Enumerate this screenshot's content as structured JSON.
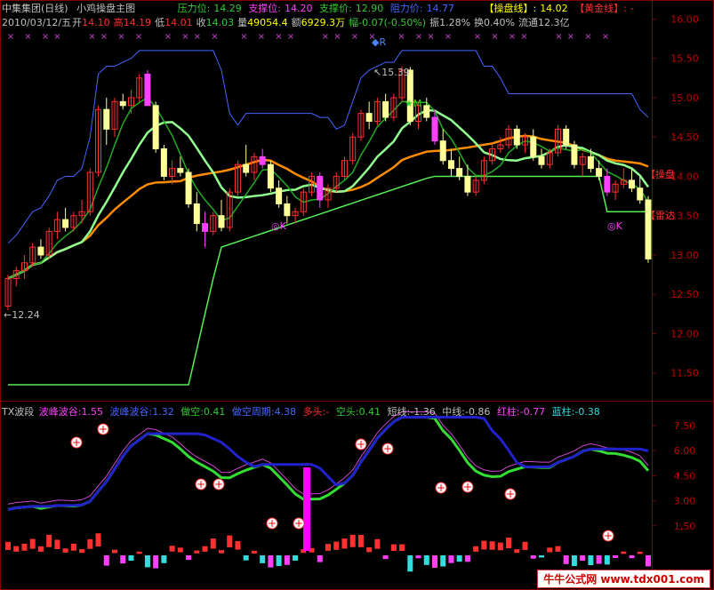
{
  "header": {
    "stock": "中集集团(日线)",
    "indicator_name": "小鸡操盘主图",
    "date": "2010/03/12/五",
    "open_label": "开",
    "open": "14.10",
    "high_label": "高",
    "high": "14.19",
    "low_label": "低",
    "low": "14.01",
    "close_label": "收",
    "close": "14.03",
    "volume_label": "量",
    "volume": "49054.4",
    "amount_label": "额",
    "amount": "6929.3万",
    "change_label": "幅",
    "change": "-0.07(-0.50%)",
    "amplitude_label": "振",
    "amplitude": "1.28%",
    "turnover_label": "换",
    "turnover": "0.40%",
    "float_label": "流通",
    "float": "12.3亿",
    "pressure_label": "压力位:",
    "pressure": "14.29",
    "support_label": "支撑位:",
    "support": "14.20",
    "support_price_label": "支撑价:",
    "support_price": "12.90",
    "resistance_label": "阻力价:",
    "resistance": "14.77",
    "op_line_label": "【操盘线】:",
    "op_line": "14.02",
    "gold_line_label": "【黄金线】:",
    "gold_line": "-",
    "tag_caopan": "【操盘",
    "tag_leida": "【雷达",
    "high_note": "15.39",
    "low_note": "12.24",
    "mark_r": "◆R",
    "mark_m": "★M",
    "mark_k1": "◎K",
    "mark_k2": "◎K"
  },
  "sub_header": {
    "name": "TX波段",
    "wave_peak_label": "波峰波谷:",
    "wave_peak": "1.55",
    "wave_peak2_label": "波峰波谷:",
    "wave_peak2": "1.32",
    "short_label": "做空:",
    "short": "0.41",
    "short_cycle_label": "做空周期:",
    "short_cycle": "4.38",
    "long_label": "多头:",
    "long": "-",
    "empty_label": "空头:",
    "empty": "0.41",
    "short_line_label": "短线:",
    "short_line": "-1.36",
    "mid_line_label": "中线:",
    "mid_line": "-0.86",
    "red_bar_label": "红柱:",
    "red_bar": "-0.77",
    "blue_bar_label": "蓝柱:",
    "blue_bar": "-0.38"
  },
  "watermark": "牛牛公式网 www.tdx001.com",
  "colors": {
    "up": "#ff3030",
    "down_fill": "#ffff99",
    "flat_green": "#22aa22",
    "magenta": "#ff40ff",
    "ma_white": "#ffffff",
    "ma_orange": "#ff8c00",
    "ma_green": "#90ff90",
    "support_green": "#55ee55",
    "resist_blue": "#4466ff",
    "sub_green": "#33dd33",
    "sub_blue": "#2222cc",
    "sub_magenta": "#cc44cc"
  },
  "chart_data": {
    "type": "candlestick",
    "main_yaxis_ticks": [
      "16.00",
      "15.50",
      "15.00",
      "14.50",
      "14.00",
      "13.50",
      "13.00",
      "12.50",
      "12.00",
      "11.50"
    ],
    "main_ylim": [
      11.2,
      16.2
    ],
    "candles": [
      [
        12.35,
        12.75,
        12.3,
        12.7
      ],
      [
        12.7,
        12.85,
        12.6,
        12.8
      ],
      [
        12.8,
        13.0,
        12.7,
        12.9
      ],
      [
        12.9,
        13.15,
        12.85,
        13.1
      ],
      [
        13.1,
        13.2,
        12.95,
        13.0
      ],
      [
        13.0,
        13.35,
        12.95,
        13.3
      ],
      [
        13.3,
        13.55,
        13.2,
        13.45
      ],
      [
        13.45,
        13.6,
        13.3,
        13.35
      ],
      [
        13.35,
        13.55,
        13.3,
        13.5
      ],
      [
        13.5,
        13.7,
        13.4,
        13.55
      ],
      [
        13.55,
        14.1,
        13.5,
        14.05
      ],
      [
        14.05,
        14.9,
        14.0,
        14.85
      ],
      [
        14.85,
        15.0,
        14.4,
        14.6
      ],
      [
        14.6,
        15.0,
        14.5,
        14.95
      ],
      [
        14.95,
        15.05,
        14.85,
        14.9
      ],
      [
        14.9,
        15.1,
        14.8,
        15.0
      ],
      [
        15.0,
        15.3,
        14.95,
        15.25
      ],
      [
        15.3,
        15.35,
        14.9,
        14.9
      ],
      [
        14.9,
        14.95,
        14.3,
        14.35
      ],
      [
        14.35,
        14.4,
        13.95,
        14.0
      ],
      [
        14.0,
        14.2,
        13.9,
        14.1
      ],
      [
        14.1,
        14.25,
        14.0,
        14.05
      ],
      [
        14.05,
        14.1,
        13.6,
        13.65
      ],
      [
        13.65,
        13.8,
        13.3,
        13.4
      ],
      [
        13.4,
        13.55,
        13.1,
        13.3
      ],
      [
        13.3,
        13.55,
        13.25,
        13.5
      ],
      [
        13.5,
        13.7,
        13.3,
        13.35
      ],
      [
        13.35,
        13.85,
        13.3,
        13.8
      ],
      [
        13.8,
        14.2,
        13.75,
        14.15
      ],
      [
        14.15,
        14.4,
        14.0,
        14.05
      ],
      [
        14.05,
        14.3,
        13.95,
        14.25
      ],
      [
        14.25,
        14.35,
        14.1,
        14.15
      ],
      [
        14.15,
        14.2,
        13.8,
        13.85
      ],
      [
        13.85,
        13.95,
        13.6,
        13.65
      ],
      [
        13.65,
        13.75,
        13.4,
        13.5
      ],
      [
        13.5,
        13.6,
        13.4,
        13.55
      ],
      [
        13.55,
        13.85,
        13.5,
        13.8
      ],
      [
        13.8,
        14.05,
        13.75,
        14.0
      ],
      [
        14.0,
        14.05,
        13.6,
        13.7
      ],
      [
        13.7,
        13.9,
        13.6,
        13.85
      ],
      [
        13.85,
        14.05,
        13.8,
        14.0
      ],
      [
        14.0,
        14.25,
        13.95,
        14.2
      ],
      [
        14.2,
        14.55,
        14.15,
        14.5
      ],
      [
        14.5,
        14.85,
        14.45,
        14.8
      ],
      [
        14.8,
        14.95,
        14.6,
        14.7
      ],
      [
        14.7,
        15.0,
        14.65,
        14.95
      ],
      [
        14.95,
        15.05,
        14.7,
        14.75
      ],
      [
        14.75,
        15.05,
        14.7,
        15.0
      ],
      [
        15.0,
        15.4,
        14.95,
        15.35
      ],
      [
        15.35,
        15.39,
        14.65,
        14.7
      ],
      [
        14.7,
        14.95,
        14.6,
        14.9
      ],
      [
        14.9,
        15.0,
        14.7,
        14.75
      ],
      [
        14.75,
        14.85,
        14.4,
        14.45
      ],
      [
        14.45,
        14.6,
        14.15,
        14.2
      ],
      [
        14.2,
        14.35,
        14.0,
        14.1
      ],
      [
        14.1,
        14.25,
        13.95,
        14.0
      ],
      [
        14.0,
        14.15,
        13.75,
        13.8
      ],
      [
        13.8,
        14.0,
        13.75,
        13.95
      ],
      [
        13.95,
        14.25,
        13.9,
        14.2
      ],
      [
        14.2,
        14.4,
        14.15,
        14.35
      ],
      [
        14.35,
        14.5,
        14.3,
        14.4
      ],
      [
        14.4,
        14.65,
        14.35,
        14.6
      ],
      [
        14.6,
        14.65,
        14.35,
        14.4
      ],
      [
        14.4,
        14.55,
        14.3,
        14.5
      ],
      [
        14.5,
        14.6,
        14.2,
        14.25
      ],
      [
        14.25,
        14.35,
        14.1,
        14.15
      ],
      [
        14.15,
        14.35,
        14.1,
        14.3
      ],
      [
        14.3,
        14.65,
        14.25,
        14.6
      ],
      [
        14.6,
        14.65,
        14.35,
        14.4
      ],
      [
        14.4,
        14.45,
        14.1,
        14.15
      ],
      [
        14.15,
        14.3,
        14.0,
        14.25
      ],
      [
        14.25,
        14.35,
        14.05,
        14.1
      ],
      [
        14.1,
        14.2,
        13.95,
        14.0
      ],
      [
        14.0,
        14.1,
        13.75,
        13.8
      ],
      [
        13.8,
        13.95,
        13.7,
        13.9
      ],
      [
        13.9,
        14.1,
        13.85,
        13.95
      ],
      [
        13.95,
        14.1,
        13.8,
        13.85
      ],
      [
        13.85,
        14.0,
        13.65,
        13.7
      ],
      [
        13.7,
        13.75,
        12.9,
        12.95
      ]
    ],
    "sub_yaxis_ticks": [
      "7.50",
      "6.00",
      "4.50",
      "3.00",
      "1.50"
    ],
    "sub_ylim": [
      0,
      8.4
    ],
    "spike_value": 5.0
  }
}
